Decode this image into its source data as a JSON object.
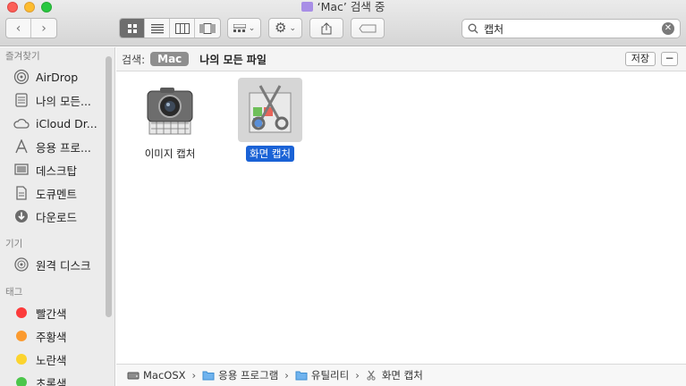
{
  "window": {
    "title": "‘Mac’ 검색 중"
  },
  "toolbar": {
    "back_icon": "chevron-left-icon",
    "forward_icon": "chevron-right-icon",
    "view_modes": [
      "icon-view",
      "list-view",
      "column-view",
      "cover-flow-view"
    ],
    "selected_view": "icon-view"
  },
  "search": {
    "value": "캡처"
  },
  "sidebar": {
    "favorites_header": "즐겨찾기",
    "favorites": [
      {
        "label": "AirDrop",
        "icon": "airdrop-icon"
      },
      {
        "label": "나의 모든...",
        "icon": "all-files-icon"
      },
      {
        "label": "iCloud Dr...",
        "icon": "cloud-icon"
      },
      {
        "label": "응용 프로...",
        "icon": "applications-icon"
      },
      {
        "label": "데스크탑",
        "icon": "desktop-icon"
      },
      {
        "label": "도큐멘트",
        "icon": "document-icon"
      },
      {
        "label": "다운로드",
        "icon": "download-icon"
      }
    ],
    "devices_header": "기기",
    "devices": [
      {
        "label": "원격 디스크",
        "icon": "disc-icon"
      }
    ],
    "tags_header": "태그",
    "tags": [
      {
        "label": "빨간색",
        "color": "#fc3b3b"
      },
      {
        "label": "주황색",
        "color": "#fb9a2f"
      },
      {
        "label": "노란색",
        "color": "#fcd42e"
      },
      {
        "label": "초록색",
        "color": "#4cc64b"
      }
    ]
  },
  "scope": {
    "label": "검색:",
    "mac": "Mac",
    "all_files": "나의 모든 파일",
    "save": "저장",
    "remove": "−"
  },
  "files": [
    {
      "name": "이미지 캡처",
      "icon": "image-capture-icon",
      "selected": false
    },
    {
      "name": "화면 캡처",
      "icon": "screenshot-icon",
      "selected": true
    }
  ],
  "path": {
    "items": [
      {
        "label": "MacOSX",
        "icon": "hard-drive-icon"
      },
      {
        "label": "응용 프로그램",
        "icon": "folder-icon"
      },
      {
        "label": "유틸리티",
        "icon": "folder-icon"
      },
      {
        "label": "화면 캡처",
        "icon": "screenshot-icon"
      }
    ]
  }
}
